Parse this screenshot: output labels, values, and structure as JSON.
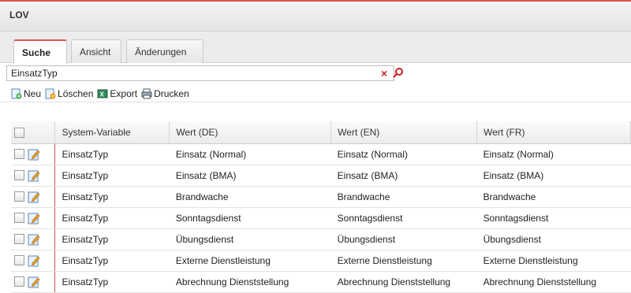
{
  "window": {
    "title": "LOV"
  },
  "tabs": [
    {
      "label": "Suche",
      "active": true
    },
    {
      "label": "Ansicht",
      "active": false
    },
    {
      "label": "Änderungen",
      "active": false
    }
  ],
  "search": {
    "value": "EinsatzTyp"
  },
  "toolbar": {
    "new_label": "Neu",
    "delete_label": "Löschen",
    "export_label": "Export",
    "print_label": "Drucken"
  },
  "table": {
    "columns": [
      "System-Variable",
      "Wert (DE)",
      "Wert (EN)",
      "Wert (FR)"
    ],
    "rows": [
      [
        "EinsatzTyp",
        "Einsatz (Normal)",
        "Einsatz (Normal)",
        "Einsatz (Normal)"
      ],
      [
        "EinsatzTyp",
        "Einsatz (BMA)",
        "Einsatz (BMA)",
        "Einsatz (BMA)"
      ],
      [
        "EinsatzTyp",
        "Brandwache",
        "Brandwache",
        "Brandwache"
      ],
      [
        "EinsatzTyp",
        "Sonntagsdienst",
        "Sonntagsdienst",
        "Sonntagsdienst"
      ],
      [
        "EinsatzTyp",
        "Übungsdienst",
        "Übungsdienst",
        "Übungsdienst"
      ],
      [
        "EinsatzTyp",
        "Externe Dienstleistung",
        "Externe Dienstleistung",
        "Externe Dienstleistung"
      ],
      [
        "EinsatzTyp",
        "Abrechnung Dienststellung",
        "Abrechnung Dienststellung",
        "Abrechnung Dienststellung"
      ]
    ]
  },
  "colors": {
    "accent": "#d9534f",
    "clear": "#cc2222"
  }
}
